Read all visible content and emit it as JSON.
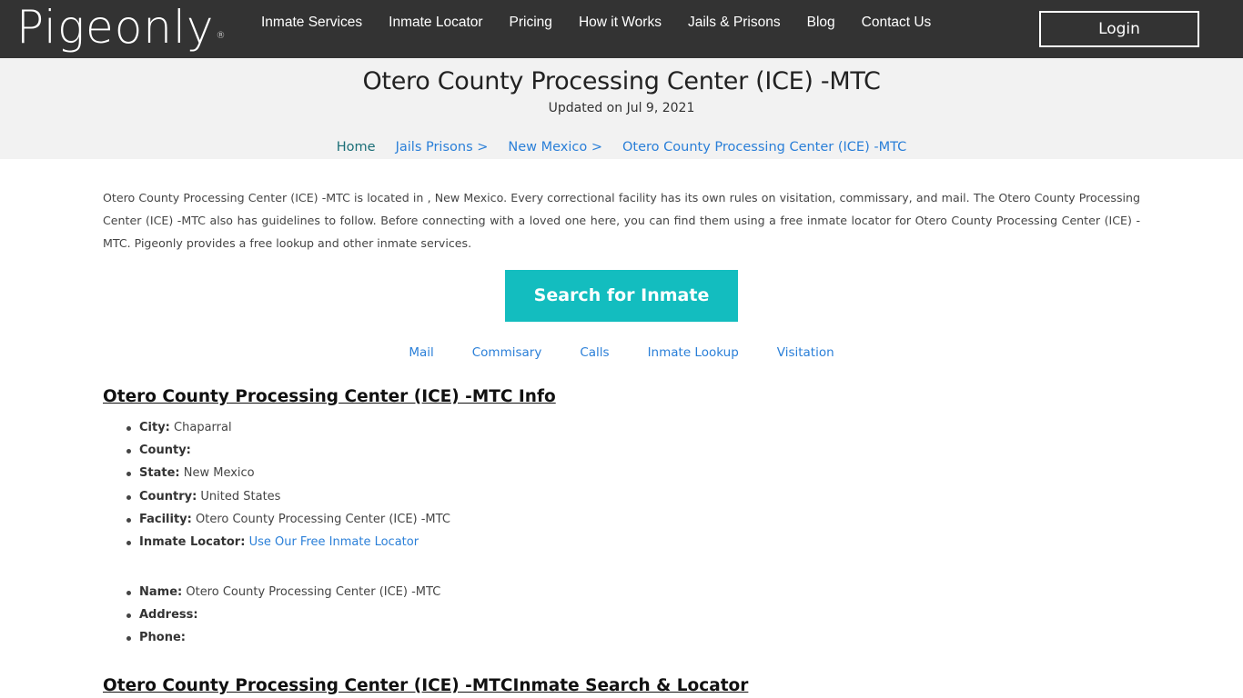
{
  "header": {
    "logo_text": "Pigeonly",
    "logo_mark": "®",
    "nav": [
      {
        "label": "Inmate Services"
      },
      {
        "label": "Inmate Locator"
      },
      {
        "label": "Pricing"
      },
      {
        "label": "How it Works"
      },
      {
        "label": "Jails & Prisons"
      },
      {
        "label": "Blog"
      },
      {
        "label": "Contact Us"
      }
    ],
    "login_label": "Login"
  },
  "hero": {
    "title": "Otero County Processing Center (ICE) -MTC",
    "updated": "Updated on Jul 9, 2021",
    "breadcrumb": [
      {
        "label": "Home"
      },
      {
        "label": "Jails Prisons >"
      },
      {
        "label": "New Mexico >"
      },
      {
        "label": "Otero County Processing Center (ICE) -MTC"
      }
    ]
  },
  "intro": "Otero County Processing Center (ICE) -MTC is located in , New Mexico. Every correctional facility has its own rules on visitation, commissary, and mail. The Otero County Processing Center (ICE) -MTC also has guidelines to follow. Before connecting with a loved one here, you can find them using a free inmate locator for Otero County Processing Center (ICE) -MTC. Pigeonly provides a free lookup and other inmate services.",
  "search_button": "Search for Inmate",
  "service_links": [
    {
      "label": "Mail"
    },
    {
      "label": "Commisary"
    },
    {
      "label": "Calls"
    },
    {
      "label": "Inmate Lookup"
    },
    {
      "label": "Visitation"
    }
  ],
  "info_section": {
    "title": "Otero County Processing Center (ICE) -MTC Info",
    "items": [
      {
        "label": "City:",
        "value": "Chaparral"
      },
      {
        "label": "County:",
        "value": ""
      },
      {
        "label": "State:",
        "value": "New Mexico"
      },
      {
        "label": "Country:",
        "value": "United States"
      },
      {
        "label": "Facility:",
        "value": "Otero County Processing Center (ICE) -MTC"
      },
      {
        "label": "Inmate Locator:",
        "link": "Use Our Free Inmate Locator"
      }
    ],
    "contact_items": [
      {
        "label": "Name:",
        "value": "Otero County Processing Center (ICE) -MTC"
      },
      {
        "label": "Address:",
        "value": ""
      },
      {
        "label": "Phone:",
        "value": ""
      }
    ]
  },
  "search_section": {
    "title": "Otero County Processing Center (ICE) -MTCInmate Search & Locator"
  },
  "colors": {
    "topbar": "#333333",
    "hero_bg": "#f2f2f2",
    "accent_teal": "#13bdbf",
    "link_blue": "#2a7fd8",
    "home_link": "#1a6e77"
  }
}
